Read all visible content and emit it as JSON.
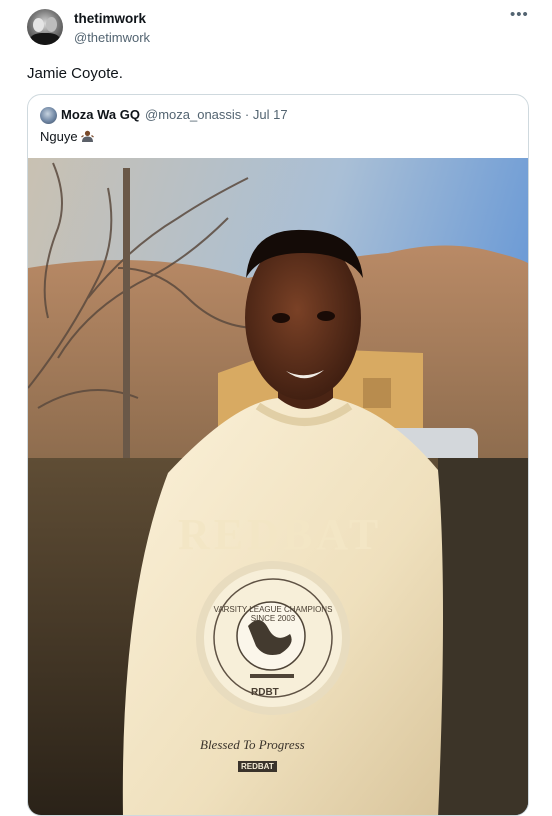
{
  "author": {
    "display_name": "thetimwork",
    "handle": "@thetimwork"
  },
  "more_icon": "more-horizontal-icon",
  "tweet": {
    "text": "Jamie Coyote."
  },
  "quoted": {
    "display_name": "Moza Wa GQ",
    "handle": "@moza_onassis",
    "separator": "·",
    "date": "Jul 17",
    "text": "Nguye",
    "emoji": "person-shrugging-emoji",
    "photo": {
      "sweatshirt_word": "REDBAT",
      "crest_ring_text": "VARSITY LEAGUE CHAMPIONS SINCE 2003",
      "crest_bottom": "RDBT",
      "script_text": "Blessed To Progress",
      "small_tag": "REDBAT"
    }
  }
}
